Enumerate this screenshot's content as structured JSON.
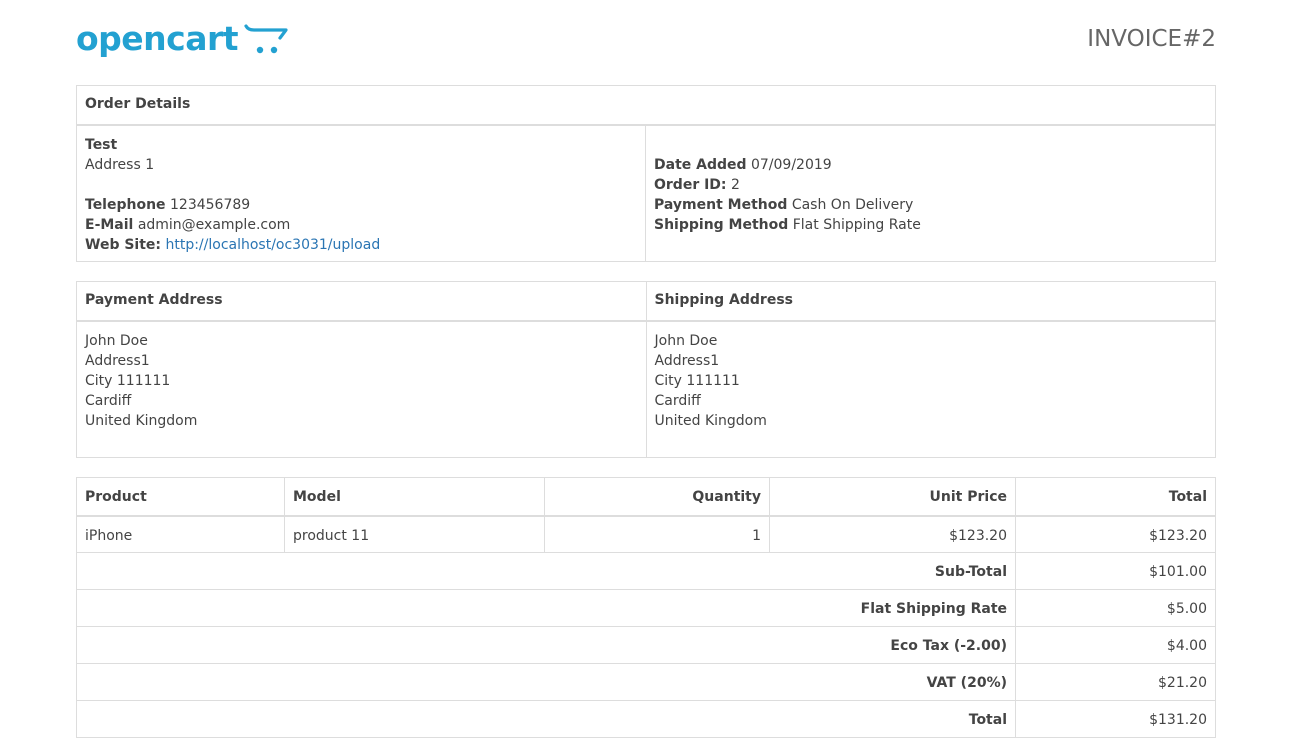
{
  "logo": {
    "text": "opencart",
    "brand_color": "#23a1d1"
  },
  "invoice_title": "INVOICE#2",
  "order_details": {
    "heading": "Order Details",
    "store": {
      "name": "Test",
      "address": "Address 1",
      "telephone_label": "Telephone",
      "telephone": "123456789",
      "email_label": "E-Mail",
      "email": "admin@example.com",
      "website_label": "Web Site:",
      "website": "http://localhost/oc3031/upload"
    },
    "info": {
      "date_added_label": "Date Added",
      "date_added": "07/09/2019",
      "order_id_label": "Order ID:",
      "order_id": "2",
      "payment_method_label": "Payment Method",
      "payment_method": "Cash On Delivery",
      "shipping_method_label": "Shipping Method",
      "shipping_method": "Flat Shipping Rate"
    }
  },
  "addresses": {
    "payment_heading": "Payment Address",
    "shipping_heading": "Shipping Address",
    "payment": [
      "John Doe",
      "Address1",
      "City 111111",
      "Cardiff",
      "United Kingdom"
    ],
    "shipping": [
      "John Doe",
      "Address1",
      "City 111111",
      "Cardiff",
      "United Kingdom"
    ]
  },
  "products": {
    "columns": [
      "Product",
      "Model",
      "Quantity",
      "Unit Price",
      "Total"
    ],
    "rows": [
      {
        "product": "iPhone",
        "model": "product 11",
        "quantity": "1",
        "unit_price": "$123.20",
        "total": "$123.20"
      }
    ],
    "totals": [
      {
        "label": "Sub-Total",
        "value": "$101.00"
      },
      {
        "label": "Flat Shipping Rate",
        "value": "$5.00"
      },
      {
        "label": "Eco Tax (-2.00)",
        "value": "$4.00"
      },
      {
        "label": "VAT (20%)",
        "value": "$21.20"
      },
      {
        "label": "Total",
        "value": "$131.20"
      }
    ]
  },
  "colors": {
    "link": "#2a75b3",
    "border": "#dddddd",
    "text": "#444444"
  }
}
